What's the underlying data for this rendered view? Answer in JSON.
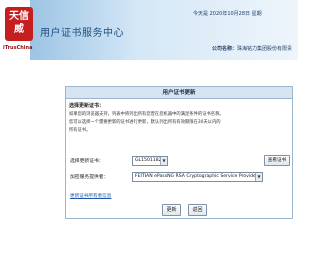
{
  "header": {
    "logo_seal_text": "天信威",
    "logo_en": "iTrusChina",
    "app_title": "用户证书服务中心",
    "date_text": "今天是 2020年10月28日 星期",
    "company_label": "公司名称：",
    "company_name": "珠海铭力集团股份有限责"
  },
  "panel": {
    "title": "用户证书更新",
    "section_heading": "选择更新证书：",
    "desc_lines": [
      "如果您的浏览器支持，列表中将列出所有您曾在您机器中的满足条件的证书名称。",
      "您可以选择一个需要更新的证书进行更新，默认列出所有有效期限在30天以内的",
      "所有证书。"
    ],
    "cert_label": "选择更新证书：",
    "cert_value": "GL1501182",
    "view_cert_button": "查看证书",
    "csp_label": "加密服务提供者：",
    "csp_value": "FEITIAN ePassNG RSA Cryptographic Service Provider",
    "change_link": "更新证书所有者信息",
    "update_button": "更新",
    "back_button": "返回"
  }
}
